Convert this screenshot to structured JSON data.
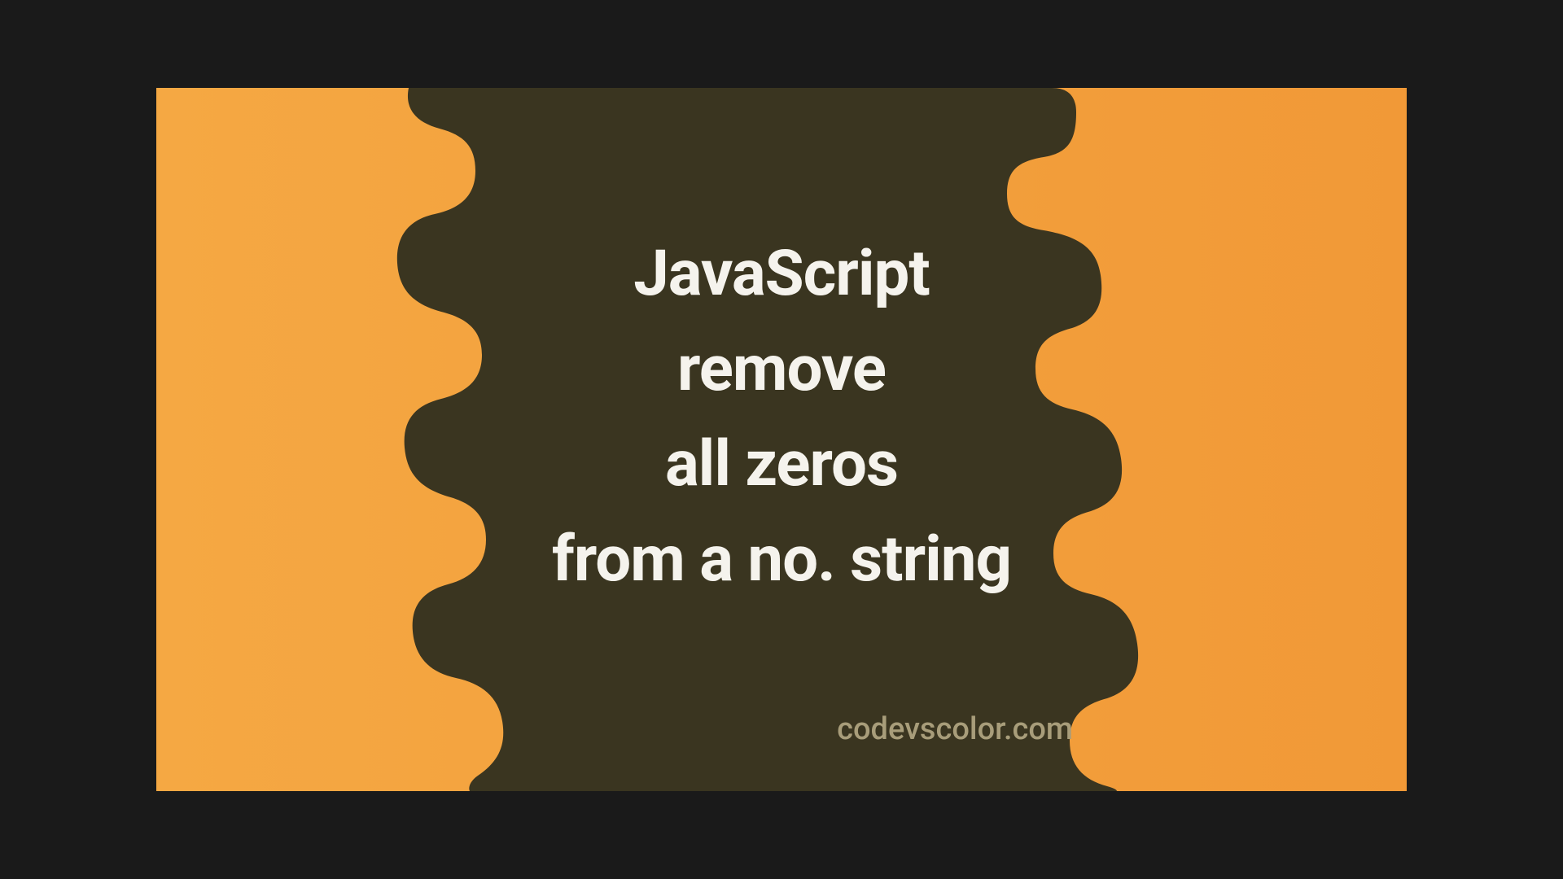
{
  "title": {
    "line1": "JavaScript",
    "line2": "remove",
    "line3": "all zeros",
    "line4": "from a no. string"
  },
  "footer": "codevscolor.com",
  "colors": {
    "background_start": "#f5a843",
    "background_end": "#f19937",
    "blob": "#3a3520",
    "text": "#f5f3ed",
    "footer_text": "#a89d7a"
  }
}
